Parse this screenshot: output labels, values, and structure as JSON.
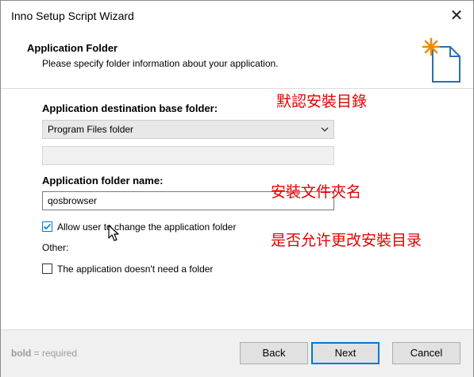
{
  "window": {
    "title": "Inno Setup Script Wizard",
    "close_glyph": "✕"
  },
  "header": {
    "title": "Application Folder",
    "subtitle": "Please specify folder information about your application."
  },
  "form": {
    "base_folder_label": "Application destination base folder:",
    "base_folder_value": "Program Files folder",
    "custom_folder_value": "",
    "folder_name_label": "Application folder name:",
    "folder_name_value": "qosbrowser",
    "allow_change_label": "Allow user to change the application folder",
    "allow_change_checked": true,
    "other_label": "Other:",
    "no_folder_label": "The application doesn't need a folder",
    "no_folder_checked": false
  },
  "annotations": {
    "base_folder": "默認安裝目錄",
    "folder_name": "安裝文件夾名",
    "allow_change": "是否允许更改安裝目录"
  },
  "footer": {
    "required_bold": "bold",
    "required_rest": " = required",
    "back_label": "Back",
    "next_label": "Next",
    "cancel_label": "Cancel"
  },
  "colors": {
    "accent": "#0078d7",
    "annotation": "#e60000",
    "footer_bg": "#f0f0f0"
  }
}
